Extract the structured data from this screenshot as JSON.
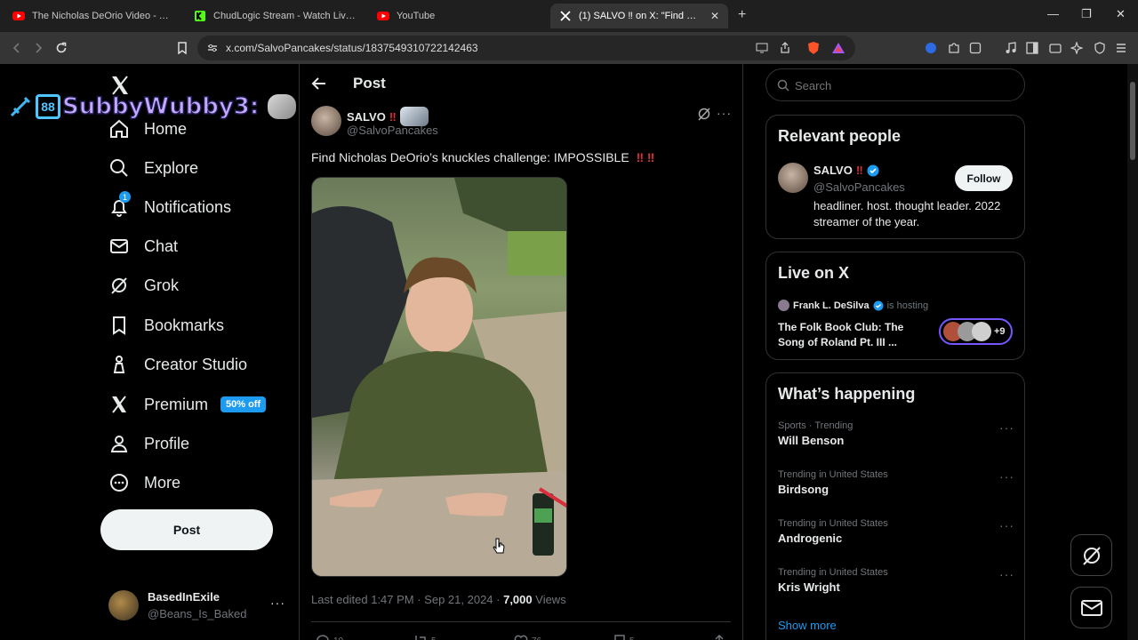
{
  "browser": {
    "tabs": [
      {
        "title": "The Nicholas DeOrio Video - YouTub",
        "icon": "youtube-icon"
      },
      {
        "title": "ChudLogic Stream - Watch Live o",
        "icon": "kick-icon"
      },
      {
        "title": "YouTube",
        "icon": "youtube-icon"
      },
      {
        "title": "(1) SALVO ‼ on X: \"Find Nicholas",
        "icon": "x-icon"
      }
    ],
    "url": "x.com/SalvoPancakes/status/1837549310722142463"
  },
  "overlay": {
    "chat_name": "SubbyWubby3:"
  },
  "sidebar": {
    "items": [
      {
        "label": "Home",
        "icon": "home-icon"
      },
      {
        "label": "Explore",
        "icon": "search-icon"
      },
      {
        "label": "Notifications",
        "icon": "bell-icon",
        "badge": "1"
      },
      {
        "label": "Chat",
        "icon": "mail-icon"
      },
      {
        "label": "Grok",
        "icon": "grok-icon"
      },
      {
        "label": "Bookmarks",
        "icon": "bookmark-icon"
      },
      {
        "label": "Creator Studio",
        "icon": "creator-studio-icon"
      },
      {
        "label": "Premium",
        "icon": "x-logo-icon",
        "badge": "50% off"
      },
      {
        "label": "Profile",
        "icon": "person-icon"
      },
      {
        "label": "More",
        "icon": "more-circle-icon"
      }
    ],
    "post_button": "Post",
    "account": {
      "name": "BasedInExile",
      "handle": "@Beans_Is_Baked"
    }
  },
  "main": {
    "header_title": "Post",
    "author": {
      "name": "SALVO",
      "emoji": "‼",
      "handle": "@SalvoPancakes"
    },
    "text": "Find Nicholas DeOrio’s knuckles challenge: IMPOSSIBLE",
    "text_emoji": "‼ ‼",
    "meta_time": "Last edited 1:47 PM · Sep 21, 2024 · ",
    "views_count": "7,000",
    "views_label": " Views",
    "actions": [
      {
        "icon": "reply-icon",
        "count": "10"
      },
      {
        "icon": "repost-icon",
        "count": "5"
      },
      {
        "icon": "like-icon",
        "count": "76"
      },
      {
        "icon": "bookmark-icon",
        "count": "5"
      },
      {
        "icon": "share-icon",
        "count": ""
      }
    ]
  },
  "right": {
    "search_placeholder": "Search",
    "relevant": {
      "title": "Relevant people",
      "name": "SALVO",
      "emoji": "‼",
      "handle": "@SalvoPancakes",
      "follow_label": "Follow",
      "bio": "headliner. host. thought leader. 2022 streamer of the year."
    },
    "live": {
      "title": "Live on X",
      "host": "Frank L. DeSilva",
      "hosting": "is hosting",
      "space_title": "The Folk Book Club: The Song of Roland Pt. III ...",
      "extra": "+9"
    },
    "happening": {
      "title": "What’s happening",
      "trends": [
        {
          "category": "Sports · Trending",
          "name": "Will Benson"
        },
        {
          "category": "Trending in United States",
          "name": "Birdsong"
        },
        {
          "category": "Trending in United States",
          "name": "Androgenic"
        },
        {
          "category": "Trending in United States",
          "name": "Kris Wright"
        }
      ],
      "show_more": "Show more"
    }
  },
  "colors": {
    "accent": "#1d9bf0",
    "background": "#000000",
    "border": "#2f3336",
    "muted": "#71767b",
    "emoji_red": "#d92d3c"
  }
}
